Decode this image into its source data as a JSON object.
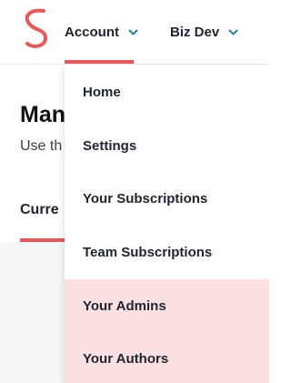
{
  "header": {
    "nav_tabs": [
      {
        "label": "Account",
        "active": true
      },
      {
        "label": "Biz Dev",
        "active": false
      }
    ]
  },
  "background": {
    "title": "Man",
    "subtitle": "Use th",
    "section_tab": "Curre"
  },
  "account_menu": {
    "items": [
      {
        "label": "Home",
        "highlighted": false
      },
      {
        "label": "Settings",
        "highlighted": false
      },
      {
        "label": "Your Subscriptions",
        "highlighted": false
      },
      {
        "label": "Team Subscriptions",
        "highlighted": false
      },
      {
        "label": "Your Admins",
        "highlighted": true
      },
      {
        "label": "Your Authors",
        "highlighted": true
      }
    ]
  },
  "colors": {
    "accent": "#e85a5a",
    "chevron": "#2a7fa0",
    "highlight_bg": "#fde0e1",
    "content_bg": "#f6f7f8"
  },
  "icons": {
    "logo": "s-logo",
    "tab_chevron": "chevron-down-icon"
  }
}
